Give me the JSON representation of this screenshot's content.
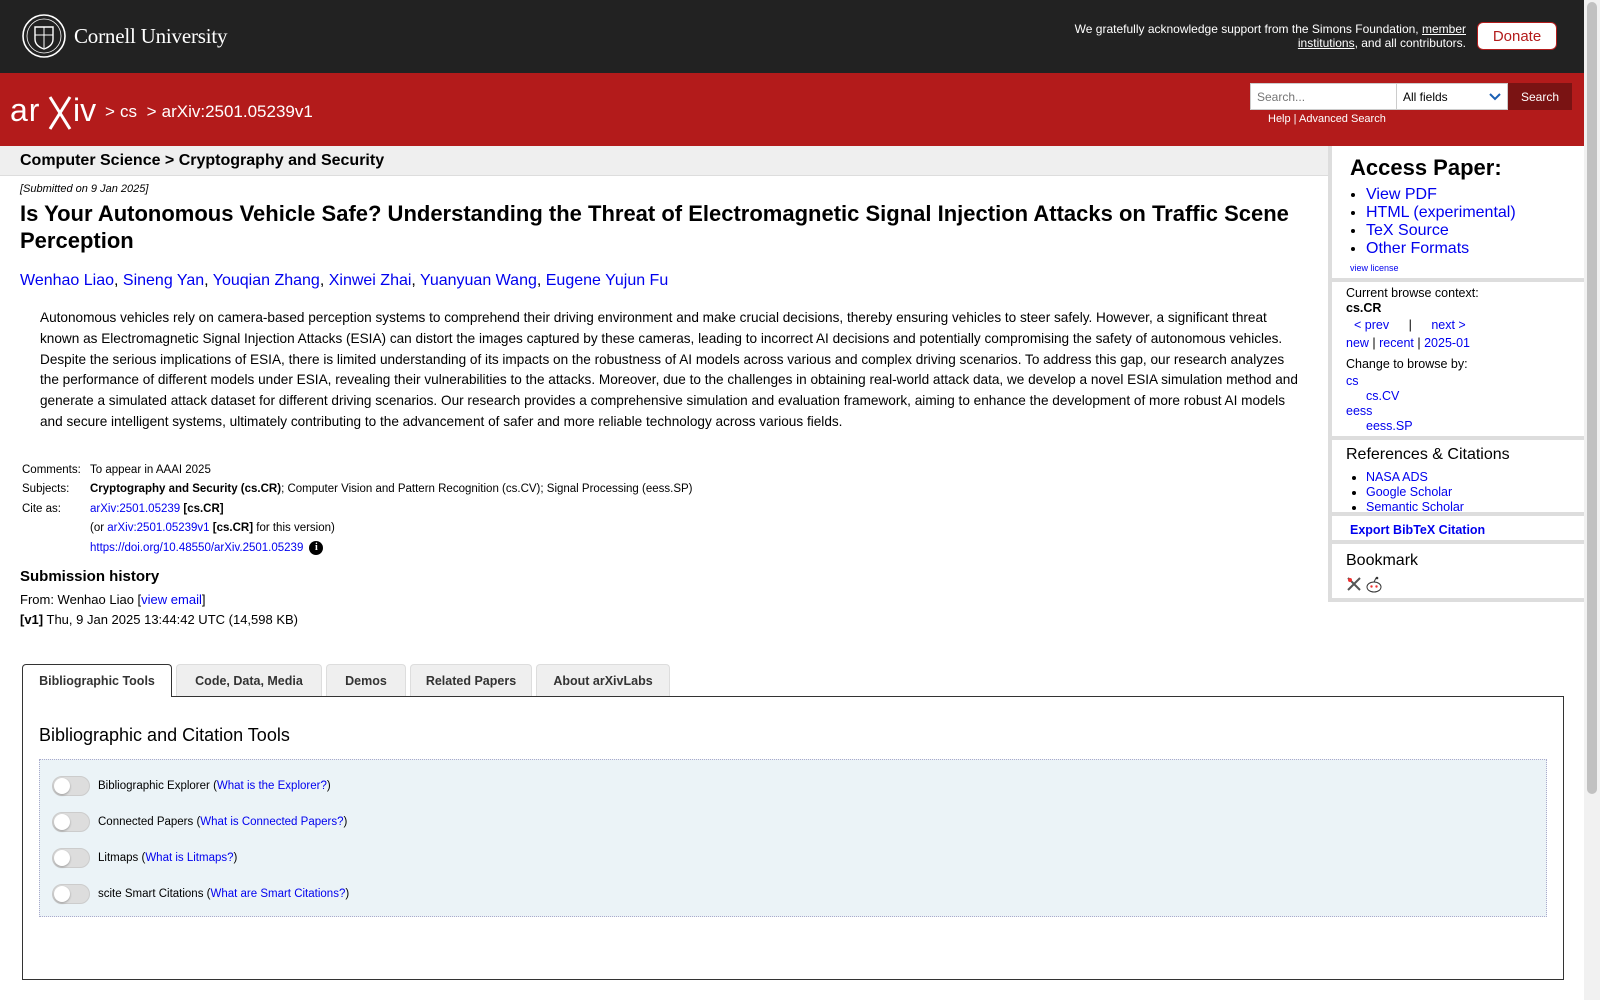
{
  "header": {
    "university": "Cornell University",
    "support_text": "We gratefully acknowledge support from the Simons Foundation,",
    "support_link": "member institutions",
    "support_suffix": ", and all contributors.",
    "donate_label": "Donate"
  },
  "nav": {
    "logo_text": "arXiv",
    "crumb_cs": "cs",
    "crumb_id": "arXiv:2501.05239v1",
    "search_placeholder": "Search...",
    "field_select": "All fields",
    "search_label": "Search",
    "help": "Help",
    "advanced": "Advanced Search"
  },
  "paper": {
    "subject_header": "Computer Science > Cryptography and Security",
    "submitted": "[Submitted on 9 Jan 2025]",
    "title": "Is Your Autonomous Vehicle Safe? Understanding the Threat of Electromagnetic Signal Injection Attacks on Traffic Scene Perception",
    "authors": [
      "Wenhao Liao",
      "Sineng Yan",
      "Youqian Zhang",
      "Xinwei Zhai",
      "Yuanyuan Wang",
      "Eugene Yujun Fu"
    ],
    "abstract": "Autonomous vehicles rely on camera-based perception systems to comprehend their driving environment and make crucial decisions, thereby ensuring vehicles to steer safely. However, a significant threat known as Electromagnetic Signal Injection Attacks (ESIA) can distort the images captured by these cameras, leading to incorrect AI decisions and potentially compromising the safety of autonomous vehicles. Despite the serious implications of ESIA, there is limited understanding of its impacts on the robustness of AI models across various and complex driving scenarios. To address this gap, our research analyzes the performance of different models under ESIA, revealing their vulnerabilities to the attacks. Moreover, due to the challenges in obtaining real-world attack data, we develop a novel ESIA simulation method and generate a simulated attack dataset for different driving scenarios. Our research provides a comprehensive simulation and evaluation framework, aiming to enhance the development of more robust AI models and secure intelligent systems, ultimately contributing to the advancement of safer and more reliable technology across various fields.",
    "comments_label": "Comments:",
    "comments": "To appear in AAAI 2025",
    "subjects_label": "Subjects:",
    "subjects_primary": "Cryptography and Security (cs.CR)",
    "subjects_rest": "; Computer Vision and Pattern Recognition (cs.CV); Signal Processing (eess.SP)",
    "cite_label": "Cite as:",
    "cite_id": "arXiv:2501.05239",
    "cite_tag": "[cs.CR]",
    "cite_or": "(or",
    "cite_version_id": "arXiv:2501.05239v1",
    "cite_version_suffix": "for this version)",
    "doi": "https://doi.org/10.48550/arXiv.2501.05239",
    "history_title": "Submission history",
    "from_label": "From: Wenhao Liao [",
    "view_email": "view email",
    "v1_tag": "[v1]",
    "v1_text": "Thu, 9 Jan 2025 13:44:42 UTC (14,598 KB)"
  },
  "sidebar": {
    "access_title": "Access Paper:",
    "access_links": [
      "View PDF",
      "HTML (experimental)",
      "TeX Source",
      "Other Formats"
    ],
    "view_license": "view license",
    "browse_context_label": "Current browse context:",
    "browse_context": "cs.CR",
    "prev": "< prev",
    "sep": "|",
    "next": "next >",
    "new": "new",
    "recent": "recent",
    "month": "2025-01",
    "change_label": "Change to browse by:",
    "browse_cs": "cs",
    "browse_cscv": "cs.CV",
    "browse_eess": "eess",
    "browse_eesssp": "eess.SP",
    "refs_title": "References & Citations",
    "refs_links": [
      "NASA ADS",
      "Google Scholar",
      "Semantic Scholar"
    ],
    "export": "Export BibTeX Citation",
    "bookmark": "Bookmark"
  },
  "tabs": {
    "items": [
      "Bibliographic Tools",
      "Code, Data, Media",
      "Demos",
      "Related Papers",
      "About arXivLabs"
    ],
    "panel_title": "Bibliographic and Citation Tools",
    "tools": [
      {
        "name": "Bibliographic Explorer",
        "link": "What is the Explorer?"
      },
      {
        "name": "Connected Papers",
        "link": "What is Connected Papers?"
      },
      {
        "name": "Litmaps",
        "link": "What is Litmaps?"
      },
      {
        "name": "scite Smart Citations",
        "link": "What are Smart Citations?"
      }
    ]
  },
  "colors": {
    "arxiv_red": "#b31b1b",
    "topbar": "#222222",
    "link": "#0000ee"
  }
}
